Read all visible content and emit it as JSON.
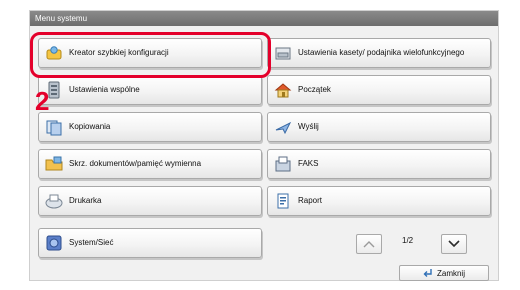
{
  "window": {
    "title": "Menu systemu"
  },
  "left_column": [
    {
      "label": "Kreator szybkiej konfiguracji",
      "icon": "wizard-icon"
    },
    {
      "label": "Ustawienia wspólne",
      "icon": "common-settings-icon"
    },
    {
      "label": "Kopiowania",
      "icon": "copy-icon"
    },
    {
      "label": "Skrz. dokumentów/pamięć wymienna",
      "icon": "document-box-icon"
    },
    {
      "label": "Drukarka",
      "icon": "printer-icon"
    },
    {
      "label": "System/Sieć",
      "icon": "system-network-icon"
    }
  ],
  "right_column": [
    {
      "label": "Ustawienia kasety/ podajnika wielofunkcyjnego",
      "icon": "cassette-icon"
    },
    {
      "label": "Początek",
      "icon": "home-icon"
    },
    {
      "label": "Wyślij",
      "icon": "send-icon"
    },
    {
      "label": "FAKS",
      "icon": "fax-icon"
    },
    {
      "label": "Raport",
      "icon": "report-icon"
    }
  ],
  "pagination": {
    "current": "1/2"
  },
  "footer": {
    "close_label": "Zamknij"
  },
  "annotation": {
    "step_number": "2",
    "highlight_color": "#e4002b"
  }
}
